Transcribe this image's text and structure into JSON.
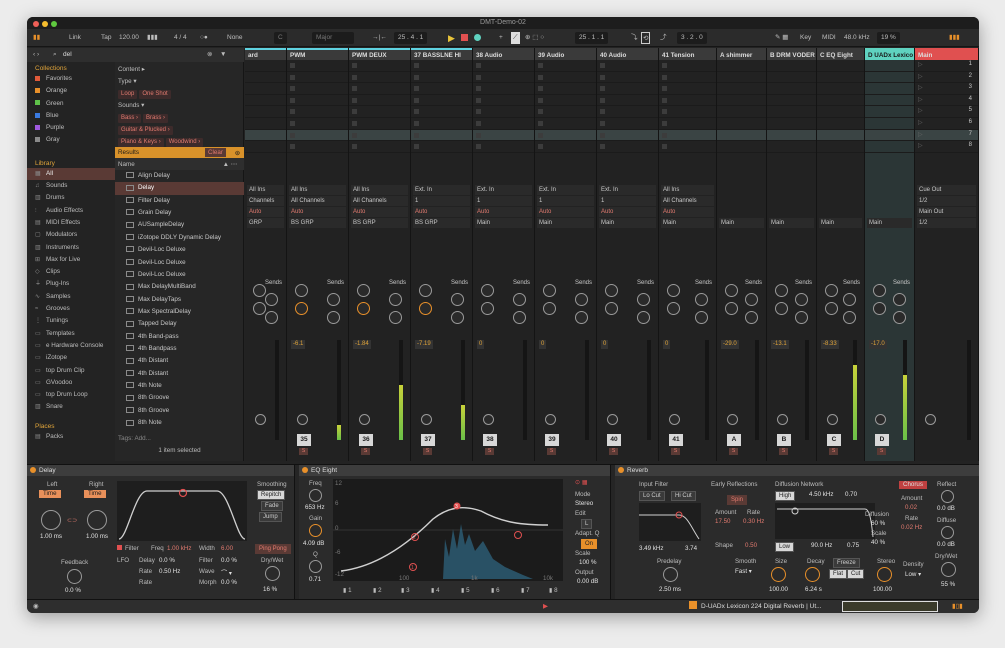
{
  "window": {
    "title": "DMT-Demo-02"
  },
  "toolbar": {
    "link": "Link",
    "tap": "Tap",
    "tempo": "120.00",
    "signature": "4 / 4",
    "quantize": "None",
    "key_field": "C",
    "scale_field": "Major",
    "position": "25 .  4 .  1",
    "loop_start": "25 .  1 .  1",
    "loop_length": "3 .  2 .  0",
    "key_label": "Key",
    "midi_label": "MIDI",
    "sample_rate": "48.0 kHz",
    "cpu": "19 %"
  },
  "browser": {
    "search": "del",
    "collections_title": "Collections",
    "collections": [
      {
        "label": "Favorites",
        "color": "#e05a3a"
      },
      {
        "label": "Orange",
        "color": "#e8902a"
      },
      {
        "label": "Green",
        "color": "#5fc24a"
      },
      {
        "label": "Blue",
        "color": "#3a7ae0"
      },
      {
        "label": "Purple",
        "color": "#a05ae0"
      },
      {
        "label": "Gray",
        "color": "#8a8a8a"
      }
    ],
    "library_title": "Library",
    "library": [
      "All",
      "Sounds",
      "Drums",
      "Audio Effects",
      "MIDI Effects",
      "Modulators",
      "Instruments",
      "Max for Live",
      "Clips",
      "Plug-Ins",
      "Samples",
      "Grooves",
      "Tunings",
      "Templates",
      "e Hardware Console",
      "iZotope",
      "top Drum Clip",
      "GVoodoo",
      "top Drum Loop",
      "Snare"
    ],
    "places_title": "Places",
    "places": [
      "Packs"
    ],
    "filters": {
      "content_label": "Content",
      "type_label": "Type",
      "type_tags": [
        "Loop",
        "One Shot"
      ],
      "sounds_label": "Sounds",
      "sound_tags_1": [
        "Bass",
        "Brass"
      ],
      "sound_tags_2": [
        "Guitar & Plucked"
      ],
      "sound_tags_3": [
        "Piano & Keys",
        "Woodwind"
      ]
    },
    "results_label": "Results",
    "clear_label": "Clear",
    "name_header": "Name",
    "results": [
      "Align Delay",
      "Delay",
      "Filter Delay",
      "Grain Delay",
      "AUSampleDelay",
      "iZotope DDLY Dynamic Delay",
      "Devil-Loc Deluxe",
      "Devil-Loc Deluxe",
      "Devil-Loc Deluxe",
      "Max DelayMultiBand",
      "Max DelayTaps",
      "Max SpectralDelay",
      "Tapped Delay",
      "4th Band-pass",
      "4th Bandpass",
      "4th Distant",
      "4th Distant",
      "4th Note",
      "8th Groove",
      "8th Groove",
      "8th Note"
    ],
    "tags_label": "Tags: Add...",
    "selected_info": "1 item selected"
  },
  "mixer": {
    "tracks": [
      {
        "name": "ard",
        "input": "All Ins",
        "channel": "Channels",
        "monitor": "Auto",
        "out": "GRP",
        "vol": "",
        "num": "",
        "color": "#5fd2e0"
      },
      {
        "name": "PWM",
        "input": "All Ins",
        "channel": "All Channels",
        "monitor": "Auto",
        "out": "BS GRP",
        "vol": "-6.1",
        "num": "35",
        "color": "#5fd2e0"
      },
      {
        "name": "PWM DEUX",
        "input": "All Ins",
        "channel": "All Channels",
        "monitor": "Auto",
        "out": "BS GRP",
        "vol": "-1.84",
        "num": "36",
        "color": "#5fd2e0"
      },
      {
        "name": "37 BASSLNE HI",
        "input": "Ext. In",
        "channel": "1",
        "monitor": "Auto",
        "out": "BS GRP",
        "vol": "-7.19",
        "num": "37",
        "color": "#5fd2e0"
      },
      {
        "name": "38 Audio",
        "input": "Ext. In",
        "channel": "1",
        "monitor": "Auto",
        "out": "Main",
        "vol": "0",
        "num": "38",
        "color": "#3a3a3a"
      },
      {
        "name": "39 Audio",
        "input": "Ext. In",
        "channel": "1",
        "monitor": "Auto",
        "out": "Main",
        "vol": "0",
        "num": "39",
        "color": "#3a3a3a"
      },
      {
        "name": "40 Audio",
        "input": "Ext. In",
        "channel": "1",
        "monitor": "Auto",
        "out": "Main",
        "vol": "0",
        "num": "40",
        "color": "#3a3a3a"
      },
      {
        "name": "41 Tension",
        "input": "All Ins",
        "channel": "All Channels",
        "monitor": "Auto",
        "out": "Main",
        "vol": "0",
        "num": "41",
        "color": "#3a3a3a"
      },
      {
        "name": "A shimmer",
        "input": "",
        "channel": "",
        "monitor": "",
        "out": "Main",
        "vol": "-29.0",
        "num": "A",
        "color": "#3a3a3a"
      },
      {
        "name": "B DRM VODER",
        "input": "",
        "channel": "",
        "monitor": "",
        "out": "Main",
        "vol": "-13.1",
        "num": "B",
        "color": "#3a3a3a"
      },
      {
        "name": "C EQ Eight",
        "input": "",
        "channel": "",
        "monitor": "",
        "out": "Main",
        "vol": "-8.33",
        "num": "C",
        "color": "#3a3a3a"
      },
      {
        "name": "D UADx Lexico",
        "input": "",
        "channel": "",
        "monitor": "",
        "out": "Main",
        "vol": "-17.0",
        "num": "D",
        "color": "#5fd2c0"
      },
      {
        "name": "Main",
        "input": "",
        "channel": "",
        "monitor": "",
        "out": "",
        "vol": "",
        "num": "",
        "color": "#e05050"
      }
    ],
    "sends_label": "Sends",
    "cue_out_label": "Cue Out",
    "cue_out_value": "1/2",
    "main_out_label": "Main Out",
    "main_out_value": "1/2",
    "scene_numbers": [
      "1",
      "2",
      "3",
      "4",
      "5",
      "6",
      "7",
      "8"
    ]
  },
  "devices": {
    "delay": {
      "title": "Delay",
      "left": "Left",
      "right": "Right",
      "time_btn": "Time",
      "left_value": "1.00 ms",
      "right_value": "1.00 ms",
      "smoothing": "Smoothing",
      "repitch": "Repitch",
      "fade": "Fade",
      "jump": "Jump",
      "filter": "Filter",
      "freq_label": "Freq",
      "freq_value": "1.00 kHz",
      "width_label": "Width",
      "width_value": "6.00",
      "lfo": "LFO",
      "delay_label": "Delay",
      "delay_value": "0.0 %",
      "filter_label": "Filter",
      "filter_value": "0.0 %",
      "rate_label": "Rate",
      "rate_value": "0.50 Hz",
      "wave_label": "Wave",
      "morph_label": "Morph",
      "morph_value": "0.0 %",
      "ping_pong": "Ping Pong",
      "dry_wet_label": "Dry/Wet",
      "dry_wet_value": "16 %",
      "feedback_label": "Feedback",
      "feedback_value": "0.0 %",
      "rate2_label": "Rate"
    },
    "eq": {
      "title": "EQ Eight",
      "freq_label": "Freq",
      "freq_value": "653 Hz",
      "gain_label": "Gain",
      "gain_value": "4.09 dB",
      "q_label": "Q",
      "q_value": "0.71",
      "db_ticks": [
        "12",
        "6",
        "0",
        "-6",
        "-12"
      ],
      "freq_ticks": [
        "100",
        "1k",
        "10k"
      ],
      "mode_label": "Mode",
      "mode_value": "Stereo",
      "edit_label": "Edit",
      "edit_value": "L",
      "adapt_label": "Adapt. Q",
      "adapt_value": "On",
      "scale_label": "Scale",
      "scale_value": "100 %",
      "output_label": "Output",
      "output_value": "0.00 dB",
      "bands": [
        "1",
        "2",
        "3",
        "4",
        "5",
        "6",
        "7",
        "8"
      ]
    },
    "reverb": {
      "title": "Reverb",
      "input_filter": "Input Filter",
      "lo_cut": "Lo Cut",
      "hi_cut": "Hi Cut",
      "freq": "3.49 kHz",
      "width": "3.74",
      "predelay_label": "Predelay",
      "predelay_value": "2.50 ms",
      "early_label": "Early Reflections",
      "spin": "Spin",
      "amount_label": "Amount",
      "amount_value": "17.50",
      "rate_label": "Rate",
      "rate_value": "0.30 Hz",
      "shape_label": "Shape",
      "shape_value": "0.50",
      "diffusion_label": "Diffusion Network",
      "high_btn": "High",
      "high_freq": "4.50 kHz",
      "high_val": "0.70",
      "low_btn": "Low",
      "low_freq": "90.0 Hz",
      "low_val": "0.75",
      "diff_label": "Diffusion",
      "diff_value": "60 %",
      "scale_label": "Scale",
      "scale_value": "40 %",
      "chorus": "Chorus",
      "ch_amount_label": "Amount",
      "ch_amount": "0.02",
      "ch_rate_label": "Rate",
      "ch_rate": "0.02 Hz",
      "smooth_label": "Smooth",
      "smooth_value": "Fast",
      "size_label": "Size",
      "size_value": "100.00",
      "decay_label": "Decay",
      "decay_value": "6.24 s",
      "freeze": "Freeze",
      "flat": "Flat",
      "cut": "Cut",
      "stereo_label": "Stereo",
      "stereo_value": "100.00",
      "density_label": "Density",
      "density_value": "Low",
      "reflect_label": "Reflect",
      "reflect_value": "0.0 dB",
      "diffuse_label": "Diffuse",
      "diffuse_value": "0.0 dB",
      "drywet_label": "Dry/Wet",
      "drywet_value": "55 %"
    }
  },
  "statusbar": {
    "device": "D-UADx Lexicon 224 Digital Reverb | Ut..."
  }
}
